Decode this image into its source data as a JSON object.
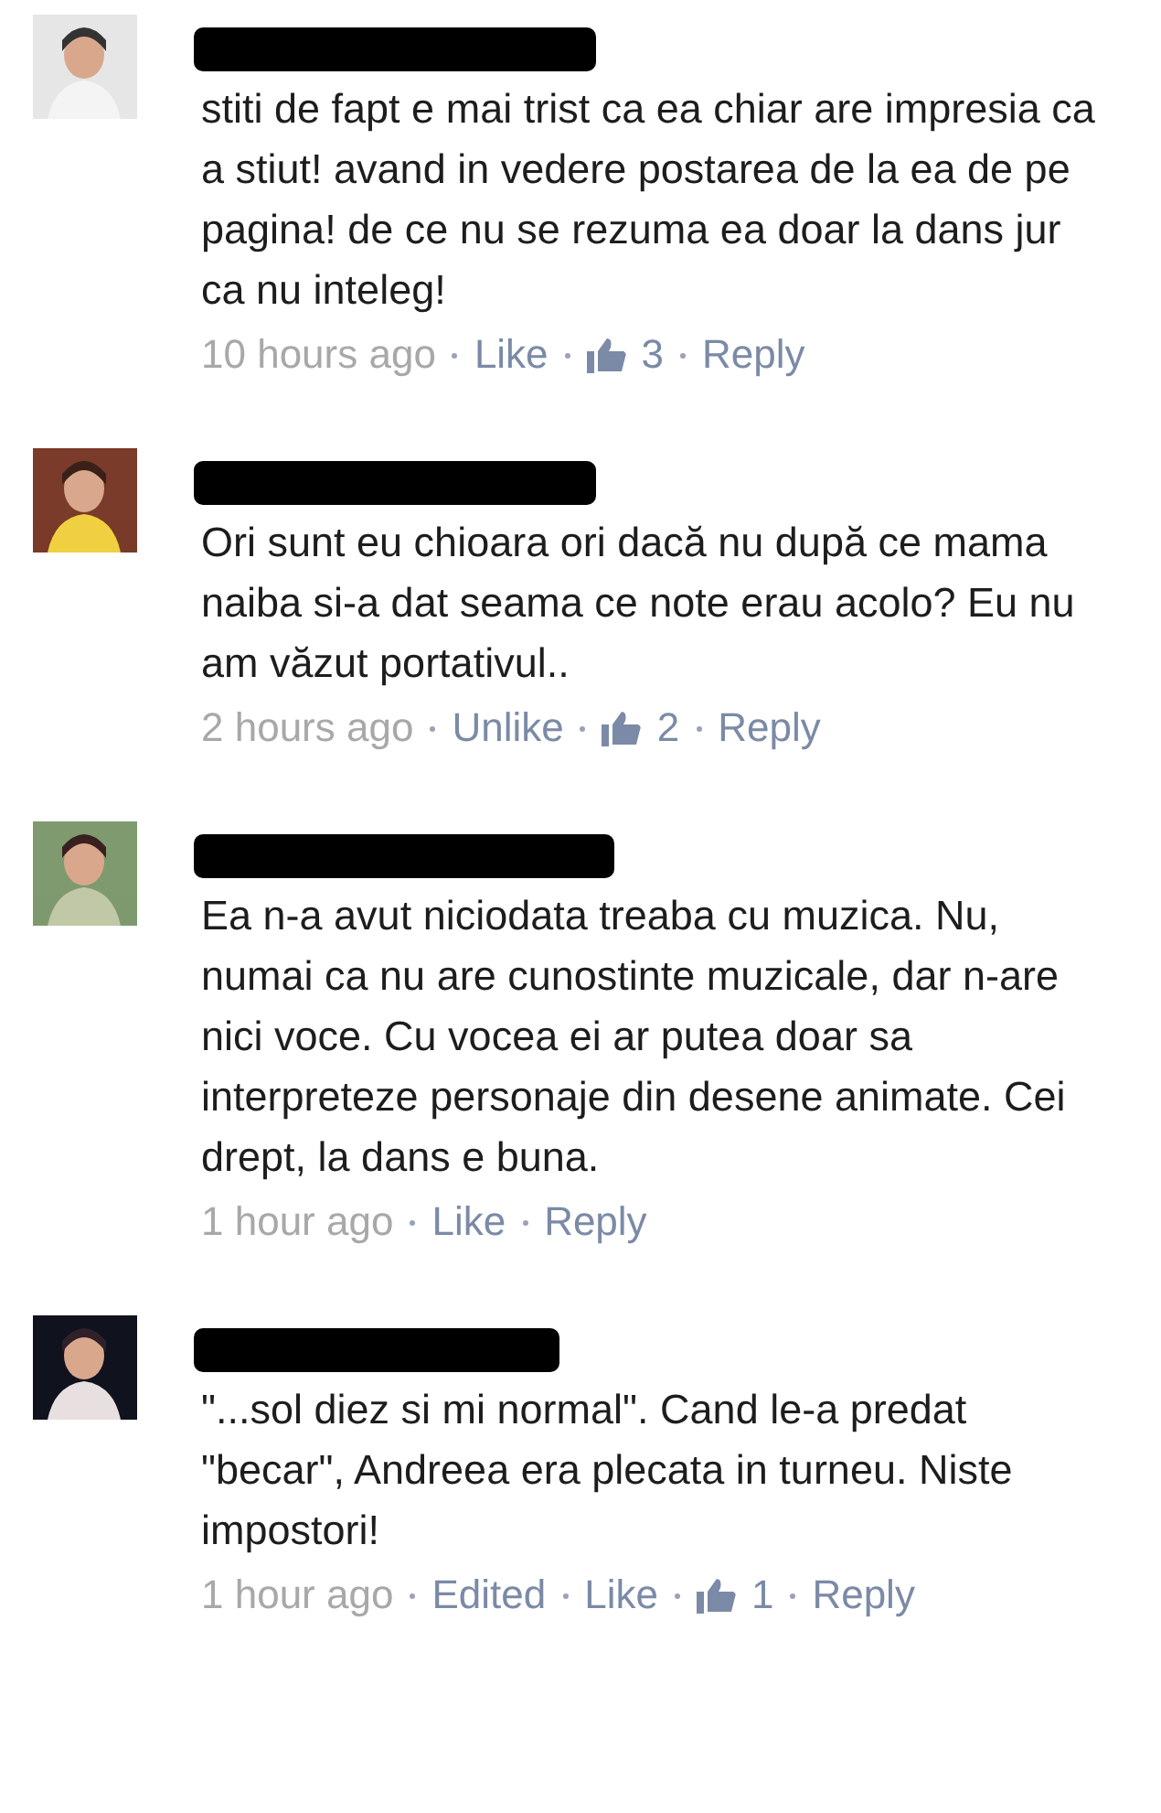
{
  "comments": [
    {
      "text": "stiti de fapt e mai trist ca ea chiar are impresia ca a stiut! avand in vedere postarea de la ea de pe pagina! de ce nu se rezuma ea doar la dans jur ca nu inteleg!",
      "meta": [
        {
          "kind": "time",
          "text": "10 hours ago"
        },
        {
          "kind": "link",
          "text": "Like"
        },
        {
          "kind": "likes",
          "text": "3"
        },
        {
          "kind": "link",
          "text": "Reply"
        }
      ]
    },
    {
      "text": "Ori sunt eu chioara ori dacă nu după ce mama naiba si-a dat seama ce note erau acolo?  Eu nu am văzut portativul..",
      "meta": [
        {
          "kind": "time",
          "text": "2 hours ago"
        },
        {
          "kind": "link",
          "text": "Unlike"
        },
        {
          "kind": "likes",
          "text": "2"
        },
        {
          "kind": "link",
          "text": "Reply"
        }
      ]
    },
    {
      "text": "Ea n-a avut niciodata treaba cu muzica. Nu, numai ca nu are cunostinte muzicale, dar n-are nici voce. Cu vocea ei ar putea doar sa interpreteze personaje din desene animate. Cei drept, la dans e buna.",
      "meta": [
        {
          "kind": "time",
          "text": "1 hour ago"
        },
        {
          "kind": "link",
          "text": "Like"
        },
        {
          "kind": "link",
          "text": "Reply"
        }
      ]
    },
    {
      "text": "\"...sol diez si mi normal\". Cand le-a predat \"becar\", Andreea era plecata in turneu. Niste impostori!",
      "meta": [
        {
          "kind": "time",
          "text": "1 hour ago"
        },
        {
          "kind": "link",
          "text": "Edited"
        },
        {
          "kind": "link",
          "text": "Like"
        },
        {
          "kind": "likes",
          "text": "1"
        },
        {
          "kind": "link",
          "text": "Reply"
        }
      ]
    }
  ]
}
